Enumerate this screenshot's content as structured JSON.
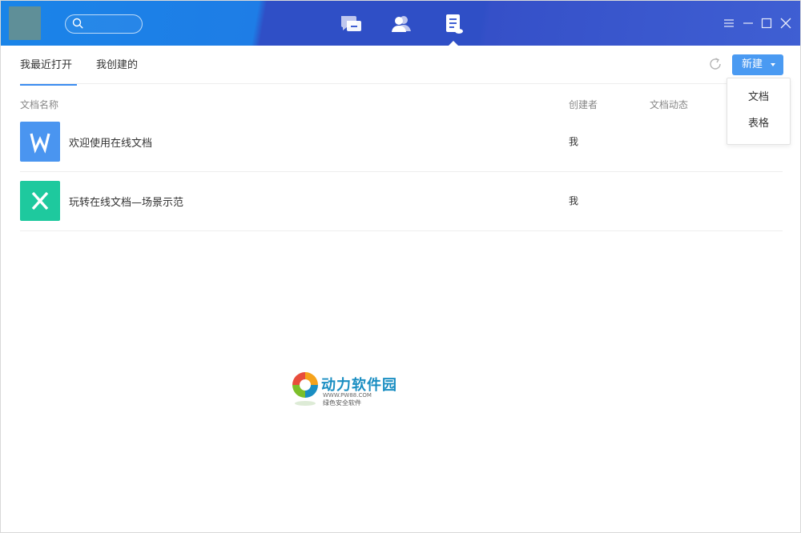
{
  "tabs": [
    {
      "label": "我最近打开",
      "active": true
    },
    {
      "label": "我创建的",
      "active": false
    }
  ],
  "toolbar": {
    "new_label": "新建"
  },
  "new_menu": {
    "items": [
      {
        "label": "文档"
      },
      {
        "label": "表格"
      }
    ]
  },
  "columns": {
    "name": "文档名称",
    "creator": "创建者",
    "activity": "文档动态"
  },
  "documents": [
    {
      "name": "欢迎使用在线文档",
      "creator": "我",
      "type": "word",
      "icon_letter": "W",
      "icon_color": "#4a95f0"
    },
    {
      "name": "玩转在线文档—场景示范",
      "creator": "我",
      "type": "sheet",
      "icon_letter": "X",
      "icon_color": "#1ec99e"
    }
  ],
  "watermark": {
    "title": "动力软件园",
    "url": "WWW.PW88.COM",
    "tagline": "绿色安全软件"
  },
  "colors": {
    "accent": "#4a9af2",
    "titlebar_left": "#1a84e8",
    "titlebar_right": "#3f5fd3"
  },
  "icons": {
    "nav": [
      "chat-icon",
      "contacts-icon",
      "documents-icon"
    ],
    "window": [
      "menu-icon",
      "minimize-icon",
      "maximize-icon",
      "close-icon"
    ]
  }
}
